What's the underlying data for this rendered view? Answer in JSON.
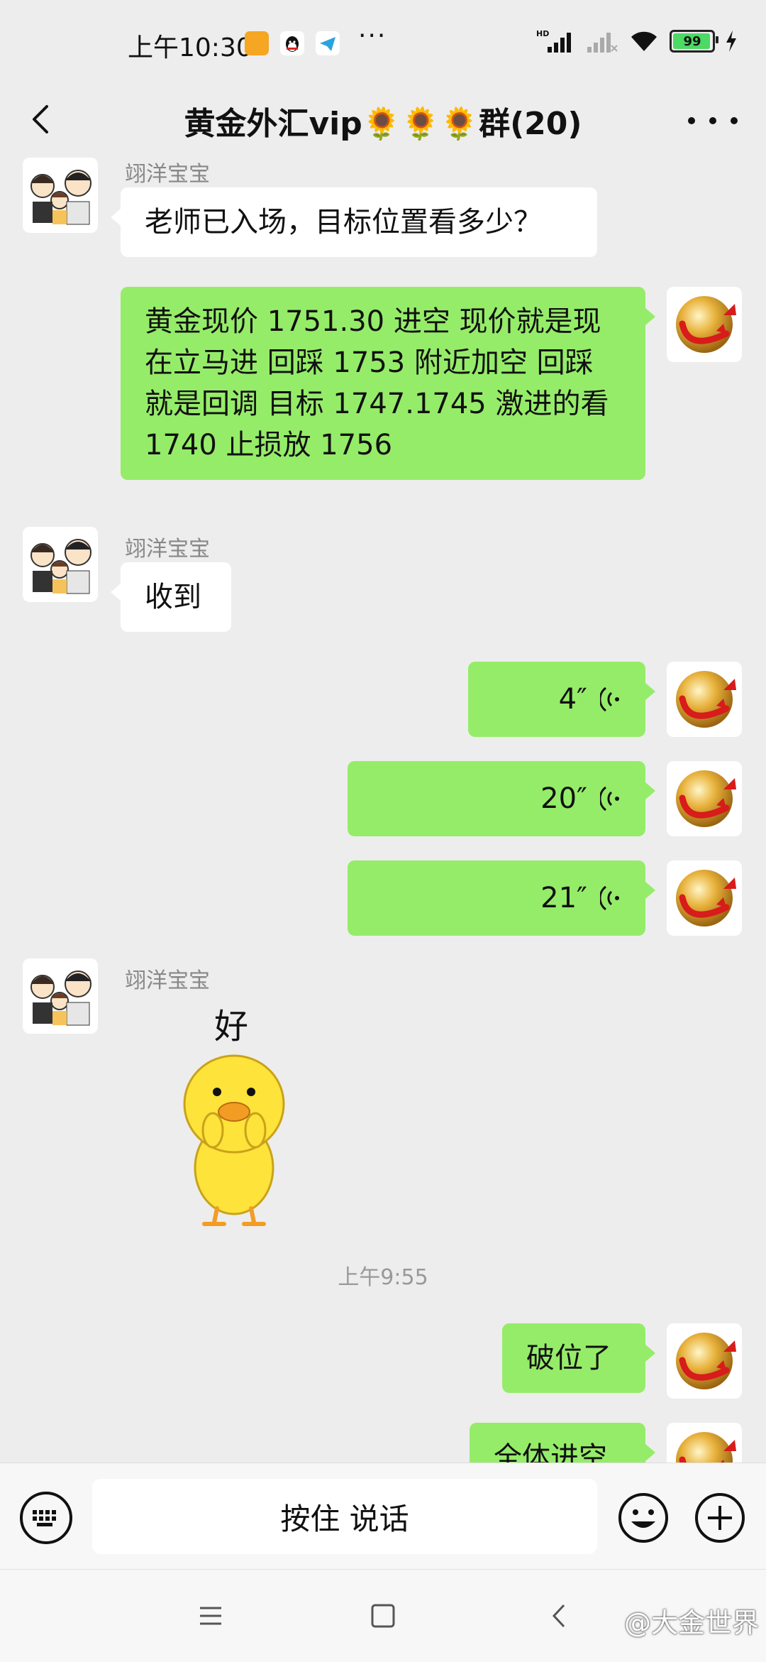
{
  "status_bar": {
    "time": "上午10:30",
    "dots": "···",
    "battery_level": "99",
    "app_icons": [
      "notes-icon",
      "qq-icon",
      "telegram-icon"
    ]
  },
  "header": {
    "title": "黄金外汇vip🌻🌻🌻群(20)"
  },
  "messages": [
    {
      "sender": "翊洋宝宝",
      "text": "老师已入场，目标位置看多少？"
    },
    {
      "text": "黄金现价 1751.30 进空 现价就是现在立马进 回踩 1753 附近加空 回踩就是回调 目标 1747.1745 激进的看 1740 止损放 1756"
    },
    {
      "sender": "翊洋宝宝",
      "text": "收到"
    },
    {
      "voice": "4″"
    },
    {
      "voice": "20″"
    },
    {
      "voice": "21″"
    },
    {
      "sender": "翊洋宝宝",
      "sticker_text": "好"
    },
    {
      "time": "上午9:55"
    },
    {
      "text": "破位了"
    },
    {
      "text": "全体进空"
    }
  ],
  "input": {
    "talk_label": "按住 说话"
  },
  "watermark": "@大金世界",
  "colors": {
    "background": "#ededed",
    "outgoing_bubble": "#95ec69",
    "incoming_bubble": "#ffffff"
  }
}
